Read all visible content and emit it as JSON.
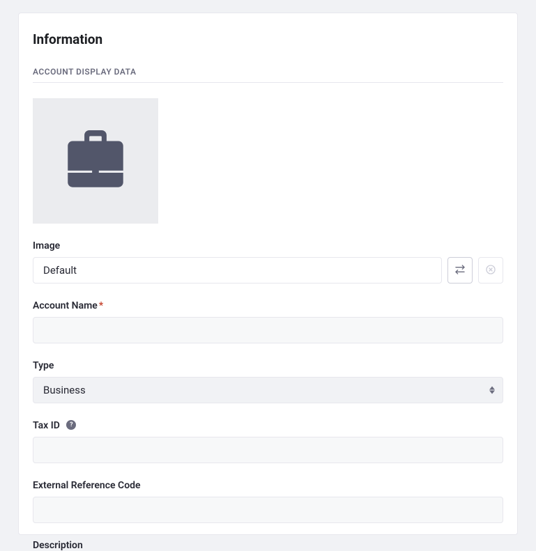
{
  "panel": {
    "title": "Information",
    "section_header": "ACCOUNT DISPLAY DATA"
  },
  "fields": {
    "image": {
      "label": "Image",
      "value": "Default"
    },
    "account_name": {
      "label": "Account Name",
      "value": ""
    },
    "type": {
      "label": "Type",
      "value": "Business"
    },
    "tax_id": {
      "label": "Tax ID",
      "value": ""
    },
    "external_ref": {
      "label": "External Reference Code",
      "value": ""
    },
    "description": {
      "label": "Description"
    }
  }
}
